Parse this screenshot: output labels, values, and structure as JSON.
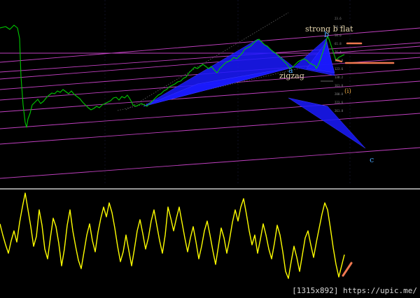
{
  "chart_data": {
    "type": "line",
    "panels": [
      {
        "name": "price",
        "series_color": "#00c800",
        "price_series": [
          [
            0,
            40
          ],
          [
            8,
            38
          ],
          [
            14,
            42
          ],
          [
            20,
            36
          ],
          [
            25,
            40
          ],
          [
            28,
            55
          ],
          [
            30,
            110
          ],
          [
            33,
            150
          ],
          [
            36,
            175
          ],
          [
            38,
            182
          ],
          [
            40,
            170
          ],
          [
            43,
            162
          ],
          [
            46,
            150
          ],
          [
            50,
            146
          ],
          [
            54,
            142
          ],
          [
            58,
            148
          ],
          [
            62,
            145
          ],
          [
            66,
            140
          ],
          [
            70,
            136
          ],
          [
            74,
            133
          ],
          [
            78,
            134
          ],
          [
            82,
            130
          ],
          [
            86,
            132
          ],
          [
            90,
            128
          ],
          [
            94,
            131
          ],
          [
            98,
            134
          ],
          [
            102,
            130
          ],
          [
            106,
            135
          ],
          [
            110,
            138
          ],
          [
            114,
            141
          ],
          [
            118,
            146
          ],
          [
            122,
            150
          ],
          [
            126,
            154
          ],
          [
            130,
            157
          ],
          [
            134,
            155
          ],
          [
            138,
            152
          ],
          [
            142,
            154
          ],
          [
            146,
            150
          ],
          [
            150,
            148
          ],
          [
            154,
            146
          ],
          [
            158,
            144
          ],
          [
            162,
            140
          ],
          [
            166,
            139
          ],
          [
            170,
            143
          ],
          [
            174,
            138
          ],
          [
            178,
            140
          ],
          [
            182,
            136
          ],
          [
            186,
            142
          ],
          [
            190,
            150
          ],
          [
            194,
            152
          ],
          [
            198,
            150
          ],
          [
            202,
            148
          ],
          [
            206,
            150
          ],
          [
            210,
            152
          ],
          [
            214,
            148
          ],
          [
            218,
            144
          ],
          [
            222,
            140
          ],
          [
            226,
            136
          ],
          [
            230,
            134
          ],
          [
            234,
            130
          ],
          [
            238,
            128
          ],
          [
            242,
            124
          ],
          [
            246,
            122
          ],
          [
            250,
            120
          ],
          [
            254,
            117
          ],
          [
            258,
            116
          ],
          [
            262,
            112
          ],
          [
            266,
            110
          ],
          [
            270,
            104
          ],
          [
            274,
            100
          ],
          [
            278,
            96
          ],
          [
            282,
            98
          ],
          [
            286,
            95
          ],
          [
            290,
            92
          ],
          [
            294,
            95
          ],
          [
            298,
            98
          ],
          [
            302,
            95
          ],
          [
            306,
            100
          ],
          [
            310,
            104
          ],
          [
            314,
            98
          ],
          [
            318,
            94
          ],
          [
            322,
            90
          ],
          [
            326,
            88
          ],
          [
            330,
            86
          ],
          [
            334,
            82
          ],
          [
            338,
            84
          ],
          [
            342,
            80
          ],
          [
            346,
            76
          ],
          [
            350,
            70
          ],
          [
            354,
            68
          ],
          [
            358,
            66
          ],
          [
            362,
            62
          ],
          [
            366,
            58
          ],
          [
            370,
            56
          ],
          [
            374,
            60
          ],
          [
            378,
            64
          ],
          [
            382,
            66
          ],
          [
            386,
            70
          ],
          [
            390,
            74
          ],
          [
            394,
            76
          ],
          [
            398,
            80
          ],
          [
            402,
            84
          ],
          [
            406,
            88
          ],
          [
            410,
            92
          ],
          [
            414,
            98
          ],
          [
            418,
            96
          ],
          [
            422,
            92
          ],
          [
            426,
            88
          ],
          [
            430,
            86
          ],
          [
            434,
            84
          ],
          [
            438,
            86
          ],
          [
            442,
            90
          ],
          [
            446,
            92
          ],
          [
            450,
            94
          ],
          [
            452,
            98
          ],
          [
            455,
            92
          ],
          [
            458,
            84
          ],
          [
            462,
            72
          ],
          [
            466,
            58
          ],
          [
            468,
            52
          ],
          [
            470,
            56
          ],
          [
            472,
            62
          ],
          [
            474,
            68
          ],
          [
            476,
            74
          ],
          [
            478,
            80
          ],
          [
            480,
            86
          ],
          [
            484,
            82
          ],
          [
            488,
            80
          ],
          [
            492,
            78
          ]
        ],
        "oscillator_series": [],
        "pattern_label_color": "#e8d8b0",
        "labels": [
          {
            "text": "strong b flat",
            "kind": "annotation"
          },
          {
            "text": "b",
            "kind": "wave"
          },
          {
            "text": "zigzag",
            "kind": "annotation"
          },
          {
            "text": "a",
            "kind": "wave"
          },
          {
            "text": "(i)",
            "kind": "wave"
          },
          {
            "text": "c",
            "kind": "wave"
          }
        ],
        "fib_levels": [
          "23.6",
          "38.2",
          "50.0",
          "61.8",
          "76.4",
          "100.0",
          "123.6",
          "138.2",
          "161.8",
          "200.0",
          "223.6",
          "261.8"
        ]
      },
      {
        "name": "oscillator",
        "series_color": "#ffff00",
        "oscillator_series": [
          [
            0,
            320
          ],
          [
            4,
            336
          ],
          [
            8,
            350
          ],
          [
            12,
            362
          ],
          [
            16,
            344
          ],
          [
            20,
            330
          ],
          [
            24,
            346
          ],
          [
            28,
            318
          ],
          [
            32,
            296
          ],
          [
            36,
            276
          ],
          [
            40,
            300
          ],
          [
            44,
            324
          ],
          [
            48,
            352
          ],
          [
            52,
            338
          ],
          [
            56,
            300
          ],
          [
            60,
            322
          ],
          [
            64,
            356
          ],
          [
            68,
            370
          ],
          [
            72,
            340
          ],
          [
            76,
            312
          ],
          [
            80,
            324
          ],
          [
            84,
            348
          ],
          [
            88,
            380
          ],
          [
            92,
            356
          ],
          [
            96,
            322
          ],
          [
            100,
            300
          ],
          [
            104,
            330
          ],
          [
            108,
            352
          ],
          [
            112,
            372
          ],
          [
            116,
            384
          ],
          [
            120,
            360
          ],
          [
            124,
            336
          ],
          [
            128,
            320
          ],
          [
            132,
            344
          ],
          [
            136,
            360
          ],
          [
            140,
            332
          ],
          [
            144,
            312
          ],
          [
            148,
            296
          ],
          [
            152,
            310
          ],
          [
            156,
            290
          ],
          [
            160,
            304
          ],
          [
            164,
            326
          ],
          [
            168,
            352
          ],
          [
            172,
            374
          ],
          [
            176,
            360
          ],
          [
            180,
            336
          ],
          [
            184,
            358
          ],
          [
            188,
            380
          ],
          [
            192,
            356
          ],
          [
            196,
            330
          ],
          [
            200,
            314
          ],
          [
            204,
            334
          ],
          [
            208,
            356
          ],
          [
            212,
            340
          ],
          [
            216,
            316
          ],
          [
            220,
            300
          ],
          [
            224,
            322
          ],
          [
            228,
            344
          ],
          [
            232,
            362
          ],
          [
            236,
            336
          ],
          [
            240,
            296
          ],
          [
            244,
            312
          ],
          [
            248,
            330
          ],
          [
            252,
            312
          ],
          [
            256,
            296
          ],
          [
            260,
            318
          ],
          [
            264,
            340
          ],
          [
            268,
            360
          ],
          [
            272,
            340
          ],
          [
            276,
            324
          ],
          [
            280,
            346
          ],
          [
            284,
            370
          ],
          [
            288,
            352
          ],
          [
            292,
            330
          ],
          [
            296,
            316
          ],
          [
            300,
            336
          ],
          [
            304,
            358
          ],
          [
            308,
            378
          ],
          [
            312,
            352
          ],
          [
            316,
            326
          ],
          [
            320,
            340
          ],
          [
            324,
            362
          ],
          [
            328,
            342
          ],
          [
            332,
            318
          ],
          [
            336,
            300
          ],
          [
            340,
            316
          ],
          [
            344,
            296
          ],
          [
            348,
            284
          ],
          [
            352,
            306
          ],
          [
            356,
            330
          ],
          [
            360,
            350
          ],
          [
            364,
            336
          ],
          [
            368,
            362
          ],
          [
            372,
            342
          ],
          [
            376,
            320
          ],
          [
            380,
            336
          ],
          [
            384,
            356
          ],
          [
            388,
            370
          ],
          [
            392,
            348
          ],
          [
            396,
            322
          ],
          [
            400,
            336
          ],
          [
            404,
            360
          ],
          [
            408,
            388
          ],
          [
            412,
            398
          ],
          [
            416,
            374
          ],
          [
            420,
            352
          ],
          [
            424,
            368
          ],
          [
            428,
            388
          ],
          [
            432,
            364
          ],
          [
            436,
            340
          ],
          [
            440,
            330
          ],
          [
            444,
            350
          ],
          [
            448,
            368
          ],
          [
            452,
            346
          ],
          [
            456,
            326
          ],
          [
            460,
            306
          ],
          [
            464,
            290
          ],
          [
            468,
            300
          ],
          [
            472,
            326
          ],
          [
            476,
            354
          ],
          [
            480,
            378
          ],
          [
            484,
            396
          ],
          [
            488,
            380
          ],
          [
            492,
            364
          ]
        ]
      }
    ],
    "xlabel": "",
    "ylabel": "",
    "grid": true,
    "legend": "none",
    "colors": {
      "background": "#000000",
      "channel_lines": "#c040c0",
      "pattern_fill": "#1a1aff",
      "price_line": "#00c800",
      "oscillator_line": "#ffff00",
      "highlight_marker": "#f07850",
      "annotation_text": "#e8d8b0",
      "wave_label": "#4aa8ff",
      "wave_label_alt": "#e0a040",
      "separator": "#c8c8c8",
      "watermark_text": "#d8d8d8"
    }
  },
  "watermark": {
    "text": "[1315x892] https://upic.me/"
  }
}
